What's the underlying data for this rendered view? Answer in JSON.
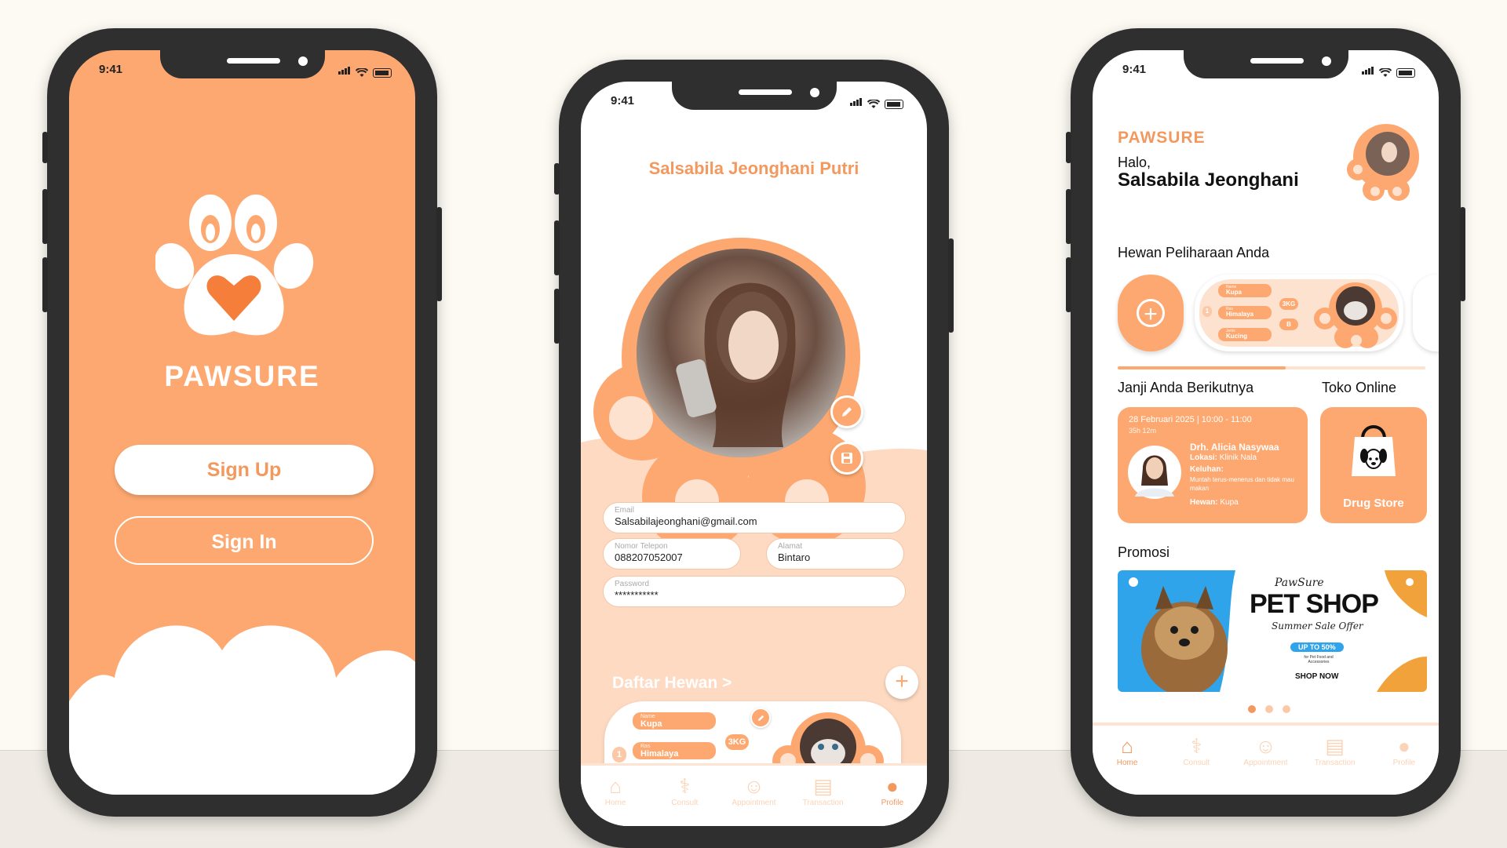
{
  "status": {
    "time": "9:41"
  },
  "welcome": {
    "app_name": "PAWSURE",
    "sign_up": "Sign Up",
    "sign_in": "Sign In"
  },
  "profile": {
    "name": "Salsabila Jeonghani Putri",
    "email_label": "Email",
    "email_value": "Salsabilajeonghani@gmail.com",
    "phone_label": "Nomor Telepon",
    "phone_value": "088207052007",
    "address_label": "Alamat",
    "address_value": "Bintaro",
    "password_label": "Password",
    "password_value": "***********",
    "pets_title": "Daftar Hewan >",
    "pet": {
      "name_label": "Name",
      "name": "Kupa",
      "race_label": "Ras",
      "race": "Himalaya",
      "type_label": "Jenis",
      "type": "Kucing",
      "weight": "3KG",
      "gender": "B",
      "index": "1"
    }
  },
  "home": {
    "brand": "PAWSURE",
    "greeting": "Halo,",
    "user": "Salsabila Jeonghani",
    "pets_title": "Hewan Peliharaan Anda",
    "appt_title": "Janji Anda Berikutnya",
    "store_title": "Toko Online",
    "appointment": {
      "datetime": "28 Februari 2025 | 10:00 - 11:00",
      "countdown": "35h 12m",
      "doctor": "Drh. Alicia Nasywaa",
      "location_label": "Lokasi:",
      "location": "Klinik Nala",
      "complaint_label": "Keluhan:",
      "complaint": "Muntah terus-menerus dan tidak mau makan",
      "pet_label": "Hewan:",
      "pet": "Kupa"
    },
    "store_label": "Drug Store",
    "promo_title": "Promosi",
    "promo": {
      "brand": "PawSure",
      "headline": "PET SHOP",
      "tagline": "Summer Sale Offer",
      "discount": "UP TO 50%",
      "sub": "for Pet Food and Accessories",
      "cta": "SHOP NOW"
    }
  },
  "nav": [
    "Home",
    "Consult",
    "Appointment",
    "Transaction",
    "Profile"
  ],
  "colors": {
    "accent": "#fda870",
    "accent_dark": "#f2995f",
    "phone": "#2f2f2f"
  }
}
